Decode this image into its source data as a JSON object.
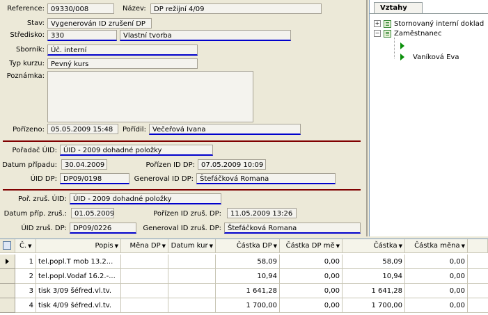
{
  "form": {
    "reference_label": "Reference:",
    "reference_value": "09330/008",
    "nazev_label": "Název:",
    "nazev_value": "DP režijní 4/09",
    "stav_label": "Stav:",
    "stav_value": "Vygenerován ID zrušení DP",
    "stredisko_label": "Středisko:",
    "stredisko_code": "330",
    "stredisko_name": "Vlastní tvorba",
    "sbornik_label": "Sborník:",
    "sbornik_value": "Úč. interní",
    "typkurzu_label": "Typ kurzu:",
    "typkurzu_value": "Pevný kurs",
    "poznamka_label": "Poznámka:",
    "poznamka_value": "",
    "porizeno_label": "Pořízeno:",
    "porizeno_value": "05.05.2009 15:48",
    "poridil_label": "Pořídil:",
    "poridil_value": "Večeřová Ivana"
  },
  "section_uid": {
    "poradac_label": "Pořadač ÚID:",
    "poradac_value": "ÚID - 2009 dohadné položky",
    "datum_pripadu_label": "Datum případu:",
    "datum_pripadu_value": "30.04.2009",
    "porizen_label": "Pořízen ID DP:",
    "porizen_value": "07.05.2009 10:09",
    "uid_dp_label": "ÚID DP:",
    "uid_dp_value": "DP09/0198",
    "generoval_label": "Generoval ID DP:",
    "generoval_value": "Štefáčková Romana"
  },
  "section_zrus": {
    "poradac_label": "Poř. zruš. ÚID:",
    "poradac_value": "ÚID - 2009 dohadné položky",
    "datum_label": "Datum příp. zruš.:",
    "datum_value": "01.05.2009",
    "porizen_label": "Pořízen ID zruš. DP:",
    "porizen_value": "11.05.2009 13:26",
    "uid_label": "ÚID zruš. DP:",
    "uid_value": "DP09/0226",
    "generoval_label": "Generoval ID zruš. DP:",
    "generoval_value": "Štefáčková Romana"
  },
  "relations": {
    "tab_label": "Vztahy",
    "items": [
      {
        "label": "Stornovaný interní doklad",
        "toggle": "+"
      },
      {
        "label": "Zaměstnanec",
        "toggle": "−"
      }
    ],
    "children": [
      {
        "label": ""
      },
      {
        "label": "Vaníková Eva"
      }
    ]
  },
  "grid": {
    "columns": [
      "Č.",
      "Popis",
      "Měna DP",
      "Datum kur",
      "Částka DP",
      "Částka DP mě",
      "Částka",
      "Částka měna"
    ],
    "rows": [
      {
        "c": "1",
        "popis": "tel.popl.T  mob  13.2...",
        "mena": "",
        "datum": "",
        "castka_dp": "58,09",
        "castka_dp_me": "0,00",
        "castka": "58,09",
        "castka_mena": "0,00"
      },
      {
        "c": "2",
        "popis": "tel.popl.Vodaf 16.2.-...",
        "mena": "",
        "datum": "",
        "castka_dp": "10,94",
        "castka_dp_me": "0,00",
        "castka": "10,94",
        "castka_mena": "0,00"
      },
      {
        "c": "3",
        "popis": "tisk 3/09 šéfred.vl.tv.",
        "mena": "",
        "datum": "",
        "castka_dp": "1 641,28",
        "castka_dp_me": "0,00",
        "castka": "1 641,28",
        "castka_mena": "0,00"
      },
      {
        "c": "4",
        "popis": "tisk 4/09 šéfred.vl.tv.",
        "mena": "",
        "datum": "",
        "castka_dp": "1 700,00",
        "castka_dp_me": "0,00",
        "castka": "1 700,00",
        "castka_mena": "0,00"
      }
    ]
  }
}
